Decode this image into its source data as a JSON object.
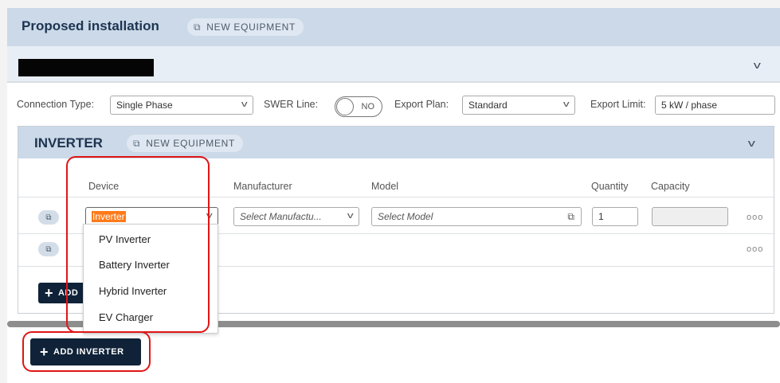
{
  "proposed": {
    "title": "Proposed installation",
    "new_equipment_label": "NEW EQUIPMENT"
  },
  "connection": {
    "type_label": "Connection Type:",
    "type_value": "Single Phase",
    "swer_label": "SWER Line:",
    "swer_value": "NO",
    "export_plan_label": "Export Plan:",
    "export_plan_value": "Standard",
    "export_limit_label": "Export Limit:",
    "export_limit_value": "5 kW / phase"
  },
  "inverter": {
    "title": "INVERTER",
    "new_equipment_label": "NEW EQUIPMENT",
    "columns": [
      "Device",
      "Manufacturer",
      "Model",
      "Quantity",
      "Capacity"
    ],
    "row": {
      "device_value": "Inverter",
      "manufacturer_placeholder": "Select Manufactu...",
      "model_placeholder": "Select Model",
      "quantity": "1",
      "capacity": ""
    },
    "add_label_partial": "ADD"
  },
  "device_options": [
    "PV Inverter",
    "Battery Inverter",
    "Hybrid Inverter",
    "EV Charger"
  ],
  "add_inverter_label": "ADD INVERTER",
  "icons": {
    "copy": "copy-plus-icon",
    "chevron": "chevron-down-icon",
    "more": "more-icon",
    "plus": "plus-icon"
  },
  "colors": {
    "header_bg": "#cbd9e8",
    "title": "#1d3450",
    "button_dark": "#0f2238",
    "highlight": "#e01515",
    "selected_text_bg": "#ff7a1a"
  }
}
